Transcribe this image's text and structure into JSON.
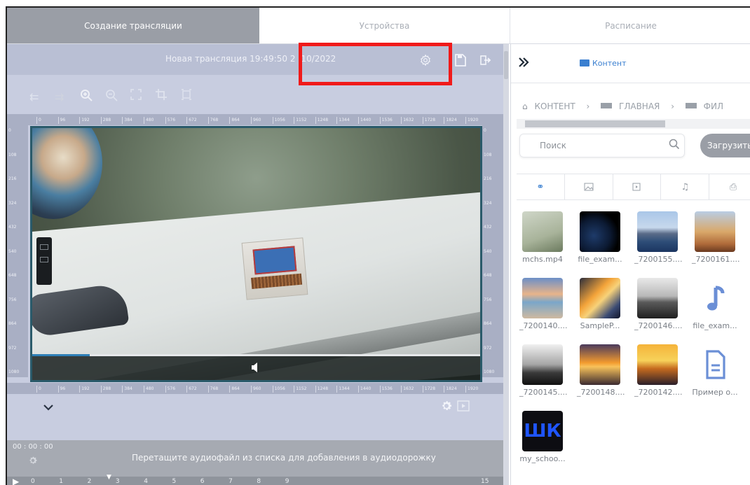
{
  "tabs": [
    "Создание трансляции",
    "Устройства",
    "Расписание"
  ],
  "editor": {
    "title": "Новая трансляция 19:49:50 2",
    "title_suffix": "10/2022",
    "ruler_ticks": [
      "0",
      "96",
      "192",
      "288",
      "384",
      "480",
      "576",
      "672",
      "768",
      "864",
      "960",
      "1056",
      "1152",
      "1248",
      "1344",
      "1440",
      "1536",
      "1632",
      "1728",
      "1824",
      "1920"
    ],
    "vruler_ticks": [
      "0",
      "108",
      "216",
      "324",
      "432",
      "540",
      "648",
      "756",
      "864",
      "972",
      "1080"
    ],
    "audio_hint": "Перетащите аудиофайл из списка для добавления в аудиодорожку",
    "time": "00 : 00 : 00",
    "timeline_marks": [
      "0",
      "1",
      "2",
      "3",
      "4",
      "5",
      "6",
      "7",
      "8",
      "9",
      "15"
    ]
  },
  "right_panel": {
    "content_link": "Контент",
    "breadcrumb": [
      "КОНТЕНТ",
      "ГЛАВНАЯ",
      "ФИЛ"
    ],
    "search_placeholder": "Поиск",
    "upload_label": "Загрузить",
    "files": [
      {
        "name": "mchs.mp4",
        "thumb": "girl"
      },
      {
        "name": "file_exam...",
        "thumb": "earth"
      },
      {
        "name": "_7200155....",
        "thumb": "mountains"
      },
      {
        "name": "_7200161....",
        "thumb": "rocks"
      },
      {
        "name": "_7200140....",
        "thumb": "beach-sunset"
      },
      {
        "name": "SampleP...",
        "thumb": "palm"
      },
      {
        "name": "_7200146....",
        "thumb": "bw-sea"
      },
      {
        "name": "file_exam...",
        "thumb": "music-note"
      },
      {
        "name": "_7200145....",
        "thumb": "bw-pier"
      },
      {
        "name": "_7200148....",
        "thumb": "sunset-clouds"
      },
      {
        "name": "_7200142....",
        "thumb": "sunset-pier"
      },
      {
        "name": "Пример о...",
        "thumb": "document"
      },
      {
        "name": "my_schoo...",
        "thumb": "logo"
      }
    ],
    "logo_text": "ШК"
  },
  "colors": {
    "accent": "#3a7fd0",
    "highlight": "#f01a1a",
    "editor_bg": "#c8cde0"
  }
}
